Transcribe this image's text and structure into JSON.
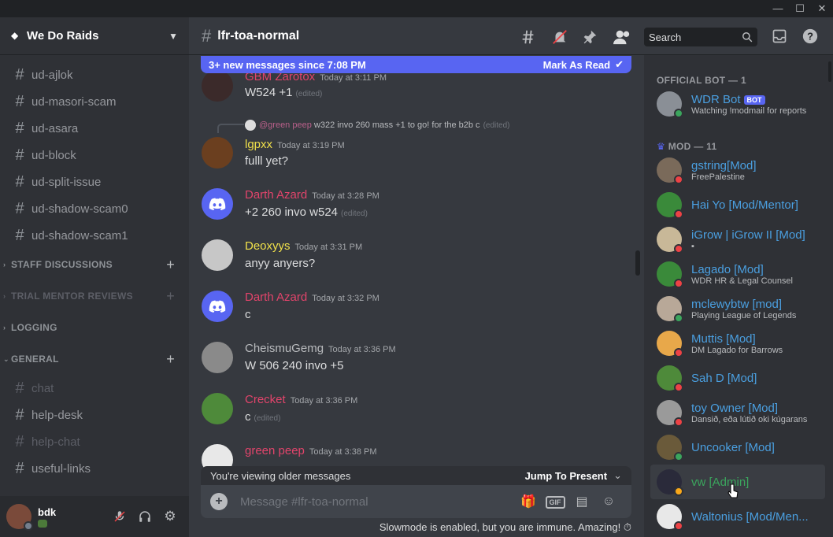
{
  "window": {
    "minimize": "—",
    "maximize": "☐",
    "close": "✕"
  },
  "guild": {
    "name": "We Do Raids"
  },
  "channels_top": [
    "ud-ajlok",
    "ud-masori-scam",
    "ud-asara",
    "ud-block",
    "ud-split-issue",
    "ud-shadow-scam0",
    "ud-shadow-scam1"
  ],
  "categories": {
    "staff": "STAFF DISCUSSIONS",
    "trial": "TRIAL MENTOR REVIEWS",
    "logging": "LOGGING",
    "general": "GENERAL"
  },
  "channels_general": [
    "chat",
    "help-desk",
    "help-chat",
    "useful-links"
  ],
  "user": {
    "name": "bdk"
  },
  "channel": {
    "name": "lfr-toa-normal"
  },
  "search": {
    "placeholder": "Search"
  },
  "new_messages": {
    "text": "3+ new messages since 7:08 PM",
    "action": "Mark As Read"
  },
  "messages": [
    {
      "author": "GBM Zarotox",
      "time": "Today at 3:11 PM",
      "body": "W524 +1",
      "edited": "(edited)",
      "color": "#e2446b"
    },
    {
      "reply_mention": "@green peep",
      "reply_text": "w322 invo 260 mass +1 to go! for the b2b c",
      "reply_edited": "(edited)",
      "author": "lgpxx",
      "time": "Today at 3:19 PM",
      "body": "fulll yet?",
      "color": "#f0e04a"
    },
    {
      "author": "Darth Azard",
      "time": "Today at 3:28 PM",
      "body": "+2 260 invo w524",
      "edited": "(edited)",
      "color": "#e2446b"
    },
    {
      "author": "Deoxyys",
      "time": "Today at 3:31 PM",
      "body": "anyy anyers?",
      "color": "#f0e04a"
    },
    {
      "author": "Darth Azard",
      "time": "Today at 3:32 PM",
      "body": "c",
      "color": "#e2446b"
    },
    {
      "author": "CheismuGemg",
      "time": "Today at 3:36 PM",
      "body": "W 506 240 invo +5",
      "color": "#96989d"
    },
    {
      "author": "Crecket",
      "time": "Today at 3:36 PM",
      "body": "c",
      "edited": "(edited)",
      "color": "#e2446b"
    },
    {
      "author": "green peep",
      "time": "Today at 3:38 PM",
      "body": "",
      "color": "#e2446b"
    }
  ],
  "older": {
    "text": "You're viewing older messages",
    "action": "Jump To Present"
  },
  "composer": {
    "placeholder": "Message #lfr-toa-normal",
    "gif": "GIF"
  },
  "slowmode": "Slowmode is enabled, but you are immune. Amazing!",
  "member_groups": {
    "bot": "OFFICIAL BOT — 1",
    "mod": "MOD — 11"
  },
  "members": [
    {
      "name": "WDR Bot",
      "tag": "BOT",
      "sub": "Watching !modmail for reports",
      "status": "online"
    },
    {
      "name": "gstring[Mod]",
      "sub": "FreePalestine",
      "status": "dnd"
    },
    {
      "name": "Hai Yo [Mod/Mentor]",
      "sub": "",
      "status": "dnd"
    },
    {
      "name": "iGrow | iGrow II [Mod]",
      "sub": "",
      "status": "dnd"
    },
    {
      "name": "Lagado [Mod]",
      "sub": "WDR HR & Legal Counsel",
      "status": "dnd"
    },
    {
      "name": "mclewybtw [mod]",
      "sub": "Playing League of Legends",
      "status": "online"
    },
    {
      "name": "Muttis [Mod]",
      "sub": "DM Lagado for Barrows",
      "status": "dnd"
    },
    {
      "name": "Sah D [Mod]",
      "sub": "",
      "status": "dnd"
    },
    {
      "name": "toy Owner [Mod]",
      "sub": "Dansið, eða lútið oki kúgarans",
      "status": "dnd"
    },
    {
      "name": "Uncooker [Mod]",
      "sub": "",
      "status": "online"
    },
    {
      "name": "vw [Admin]",
      "sub": "",
      "status": "idle",
      "color": "#3ba55d"
    },
    {
      "name": "Waltonius [Mod/Men...",
      "sub": "",
      "status": "dnd"
    }
  ]
}
